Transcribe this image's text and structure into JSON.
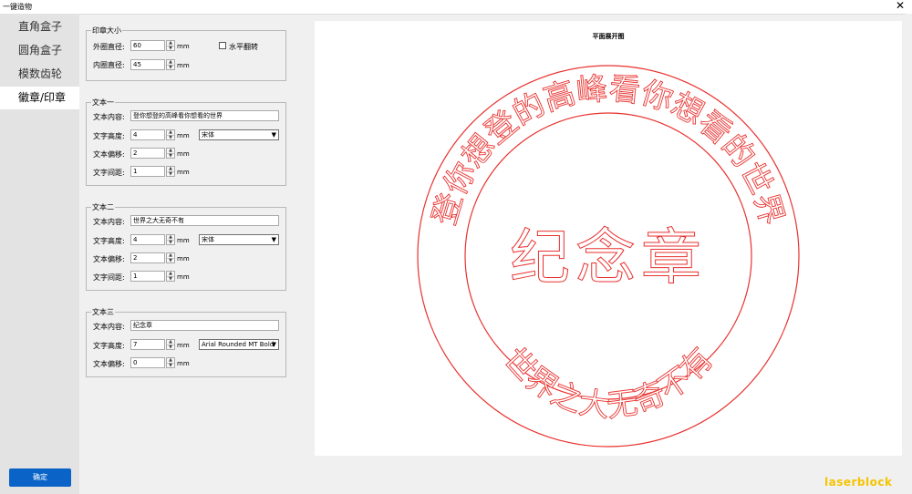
{
  "window": {
    "title": "一键造物",
    "close_glyph": "✕"
  },
  "sidebar": {
    "items": [
      {
        "label": "直角盒子"
      },
      {
        "label": "圆角盒子"
      },
      {
        "label": "模数齿轮"
      },
      {
        "label": "徽章/印章",
        "active": true
      }
    ]
  },
  "confirm_button": "确定",
  "stamp_size": {
    "title": "印章大小",
    "outer_label": "外圈直径:",
    "outer_value": "60",
    "inner_label": "内圈直径:",
    "inner_value": "45",
    "unit": "mm",
    "flip_label": "水平翻转",
    "flip_checked": false
  },
  "text1": {
    "title": "文本一",
    "content_label": "文本内容:",
    "content": "登你想登的高峰看你想看的世界",
    "height_label": "文字高度:",
    "height": "4",
    "font": "宋体",
    "offset_label": "文本偏移:",
    "offset": "2",
    "spacing_label": "文字间距:",
    "spacing": "1",
    "unit": "mm"
  },
  "text2": {
    "title": "文本二",
    "content_label": "文本内容:",
    "content": "世界之大无奇不有",
    "height_label": "文字高度:",
    "height": "4",
    "font": "宋体",
    "offset_label": "文本偏移:",
    "offset": "2",
    "spacing_label": "文字间距:",
    "spacing": "1",
    "unit": "mm"
  },
  "text3": {
    "title": "文本三",
    "content_label": "文本内容:",
    "content": "纪念章",
    "height_label": "文字高度:",
    "height": "7",
    "font": "Arial Rounded MT Bold",
    "offset_label": "文本偏移:",
    "offset": "0",
    "unit": "mm"
  },
  "preview": {
    "title": "平面展开图",
    "stroke_color": "#e8322f"
  },
  "watermark": "laserblock"
}
